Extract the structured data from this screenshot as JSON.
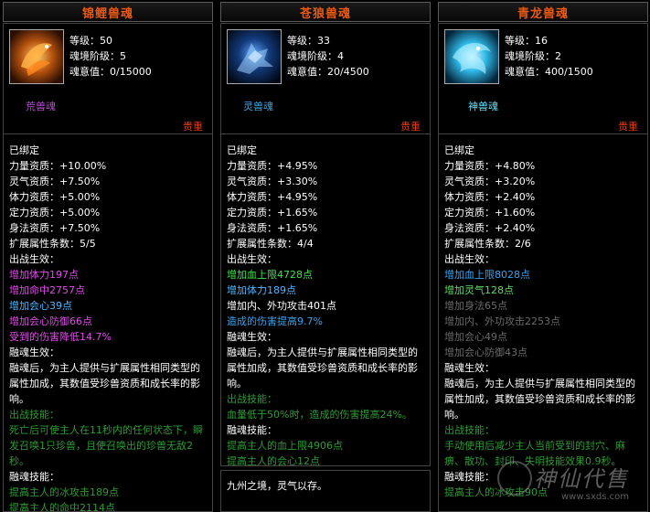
{
  "panels": [
    {
      "title": "锦鲤兽魂",
      "stats": [
        "等级：50",
        "魂境阶级：5",
        "魂意值：0/15000"
      ],
      "grade": "荒兽魂",
      "rarity": "贵重",
      "lines": [
        {
          "t": "已绑定",
          "c": "white"
        },
        {
          "t": "力量资质：+10.00%",
          "c": "white"
        },
        {
          "t": "灵气资质：+7.50%",
          "c": "white"
        },
        {
          "t": "体力资质：+5.00%",
          "c": "white"
        },
        {
          "t": "定力资质：+5.00%",
          "c": "white"
        },
        {
          "t": "身法资质：+7.50%",
          "c": "white"
        },
        {
          "t": "扩展属性条数：5/5",
          "c": "white"
        },
        {
          "t": "出战生效：",
          "c": "white"
        },
        {
          "t": "增加体力197点",
          "c": "mag"
        },
        {
          "t": "增加命中2757点",
          "c": "mag"
        },
        {
          "t": "增加会心39点",
          "c": "cyan"
        },
        {
          "t": "增加会心防御66点",
          "c": "mag"
        },
        {
          "t": "受到的伤害降低14.7%",
          "c": "mag"
        },
        {
          "t": "融魂生效：",
          "c": "white"
        },
        {
          "t": "融魂后，为主人提供与扩展属性相同类型的属性加成，其数值受珍兽资质和成长率的影响。",
          "c": "white",
          "wrap": true
        },
        {
          "t": "出战技能：",
          "c": "dgreen"
        },
        {
          "t": "死亡后可使主人在11秒内的任何状态下，瞬发召唤1只珍兽，且使召唤出的珍兽无敌2秒。",
          "c": "dgreen",
          "wrap": true
        },
        {
          "t": "融魂技能：",
          "c": "white"
        },
        {
          "t": "提高主人的冰攻击189点",
          "c": "dgreen"
        },
        {
          "t": "提高主人的命中2114点",
          "c": "dgreen"
        }
      ]
    },
    {
      "title": "苍狼兽魂",
      "stats": [
        "等级：33",
        "魂境阶级：4",
        "魂意值：20/4500"
      ],
      "grade": "灵兽魂",
      "rarity": "贵重",
      "lines": [
        {
          "t": "已绑定",
          "c": "white"
        },
        {
          "t": "力量资质：+4.95%",
          "c": "white"
        },
        {
          "t": "灵气资质：+3.30%",
          "c": "white"
        },
        {
          "t": "体力资质：+4.95%",
          "c": "white"
        },
        {
          "t": "定力资质：+1.65%",
          "c": "white"
        },
        {
          "t": "身法资质：+1.65%",
          "c": "white"
        },
        {
          "t": "扩展属性条数：4/4",
          "c": "white"
        },
        {
          "t": "出战生效：",
          "c": "white"
        },
        {
          "t": "增加血上限4728点",
          "c": "green"
        },
        {
          "t": "增加体力189点",
          "c": "cyan"
        },
        {
          "t": "增加内、外功攻击401点",
          "c": "white"
        },
        {
          "t": "造成的伤害提高9.7%",
          "c": "blue"
        },
        {
          "t": "融魂生效：",
          "c": "white"
        },
        {
          "t": "融魂后，为主人提供与扩展属性相同类型的属性加成，其数值受珍兽资质和成长率的影响。",
          "c": "white",
          "wrap": true
        },
        {
          "t": "出战技能：",
          "c": "dgreen"
        },
        {
          "t": "血量低于50%时，造成的伤害提高24%。",
          "c": "dgreen"
        },
        {
          "t": "融魂技能：",
          "c": "white"
        },
        {
          "t": "提高主人的血上限4906点",
          "c": "dgreen"
        },
        {
          "t": "提高主人的会心12点",
          "c": "dgreen"
        }
      ],
      "footer": "九州之境，灵气以存。"
    },
    {
      "title": "青龙兽魂",
      "stats": [
        "等级：16",
        "魂境阶级：2",
        "魂意值：400/1500"
      ],
      "grade": "神兽魂",
      "rarity": "贵重",
      "lines": [
        {
          "t": "已绑定",
          "c": "white"
        },
        {
          "t": "力量资质：+4.80%",
          "c": "white"
        },
        {
          "t": "灵气资质：+3.20%",
          "c": "white"
        },
        {
          "t": "体力资质：+2.40%",
          "c": "white"
        },
        {
          "t": "定力资质：+1.60%",
          "c": "white"
        },
        {
          "t": "身法资质：+2.40%",
          "c": "white"
        },
        {
          "t": "扩展属性条数：2/6",
          "c": "white"
        },
        {
          "t": "出战生效：",
          "c": "white"
        },
        {
          "t": "增加血上限8028点",
          "c": "blue"
        },
        {
          "t": "增加灵气128点",
          "c": "lgreen"
        },
        {
          "t": "增加身法65点",
          "c": "grey"
        },
        {
          "t": "增加内、外功攻击2253点",
          "c": "grey"
        },
        {
          "t": "增加会心49点",
          "c": "grey"
        },
        {
          "t": "增加会心防御43点",
          "c": "grey"
        },
        {
          "t": "融魂生效：",
          "c": "white"
        },
        {
          "t": "融魂后，为主人提供与扩展属性相同类型的属性加成，其数值受珍兽资质和成长率的影响。",
          "c": "white",
          "wrap": true
        },
        {
          "t": "出战技能：",
          "c": "dgreen"
        },
        {
          "t": "手动使用后减少主人当前受到的封穴、麻痹、散功、封印、失明技能效果0.9秒。",
          "c": "dgreen",
          "wrap": true
        },
        {
          "t": "融魂技能：",
          "c": "white"
        },
        {
          "t": "提高主人的冰攻击90点",
          "c": "dgreen"
        }
      ]
    }
  ],
  "watermark": {
    "text": "神仙代售",
    "url": "www.sxds.com"
  }
}
